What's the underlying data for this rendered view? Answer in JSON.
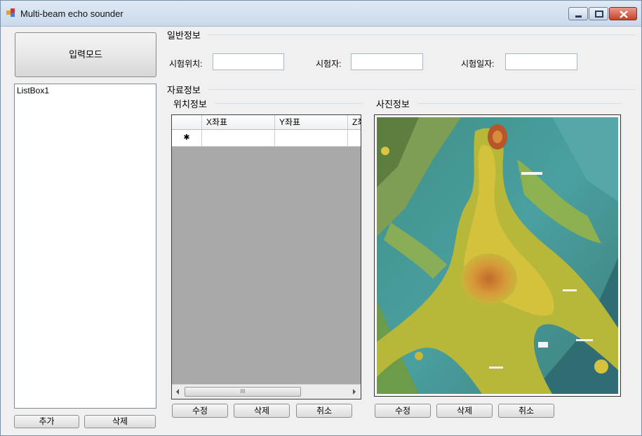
{
  "window": {
    "title": "Multi-beam echo sounder"
  },
  "left_panel": {
    "mode_button": "입력모드",
    "listbox_item": "ListBox1",
    "add_button": "추가",
    "delete_button": "삭제"
  },
  "general_info": {
    "title": "일반정보",
    "fields": [
      {
        "label": "시험위치:",
        "value": ""
      },
      {
        "label": "시험자:",
        "value": ""
      },
      {
        "label": "시험일자:",
        "value": ""
      }
    ]
  },
  "data_info": {
    "title": "자료정보",
    "position": {
      "title": "위치정보",
      "columns": [
        "X좌표",
        "Y좌표",
        "Z좌"
      ],
      "new_row_marker": "✱",
      "scroll_grip": "III",
      "buttons": {
        "edit": "수정",
        "delete": "삭제",
        "cancel": "취소"
      }
    },
    "photo": {
      "title": "사진정보",
      "icon": "bathymetry-image",
      "buttons": {
        "edit": "수정",
        "delete": "삭제",
        "cancel": "취소"
      }
    }
  },
  "colors": {
    "grid_background": "#a9a9a9",
    "titlebar": "#d3e1f1",
    "close_button": "#c7412b"
  }
}
